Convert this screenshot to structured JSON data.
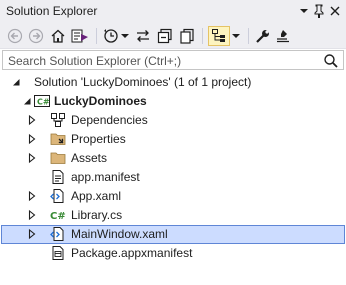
{
  "window": {
    "title": "Solution Explorer"
  },
  "search": {
    "placeholder": "Search Solution Explorer (Ctrl+;)"
  },
  "solution": {
    "label": "Solution 'LuckyDominoes' (1 of 1 project)"
  },
  "project": {
    "label": "LuckyDominoes"
  },
  "items": [
    {
      "label": "Dependencies",
      "icon": "dependencies-icon",
      "expandable": true
    },
    {
      "label": "Properties",
      "icon": "properties-folder-icon",
      "expandable": true
    },
    {
      "label": "Assets",
      "icon": "folder-icon",
      "expandable": true
    },
    {
      "label": "app.manifest",
      "icon": "manifest-file-icon",
      "expandable": false
    },
    {
      "label": "App.xaml",
      "icon": "xaml-file-icon",
      "expandable": true
    },
    {
      "label": "Library.cs",
      "icon": "csharp-file-icon",
      "expandable": true
    },
    {
      "label": "MainWindow.xaml",
      "icon": "xaml-file-icon",
      "expandable": true,
      "selected": true
    },
    {
      "label": "Package.appxmanifest",
      "icon": "appxmanifest-file-icon",
      "expandable": false
    }
  ],
  "colors": {
    "chrome_bg": "#eeeef2",
    "selection_bg": "#ccdcff",
    "selection_border": "#5f86d6",
    "active_toggle_bg": "#fdf4bf",
    "csharp_green": "#388a34"
  }
}
